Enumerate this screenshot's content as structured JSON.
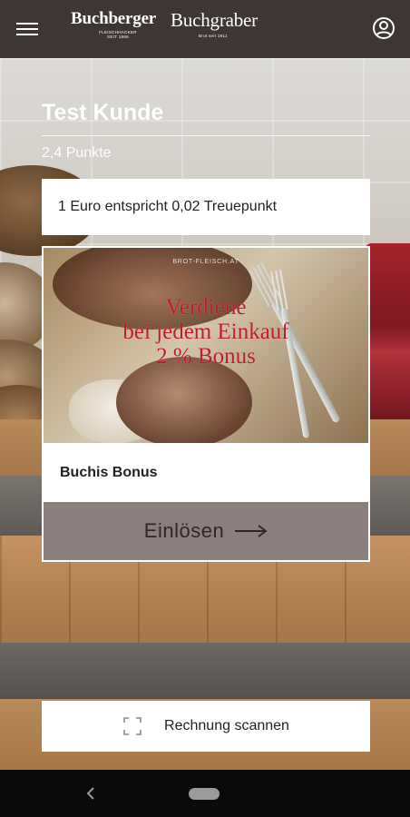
{
  "app": {
    "logo": {
      "brand_primary": "Buchberger",
      "brand_primary_sub": "FLEISCHHACKER SEIT 1966",
      "brand_secondary": "Buchgraber",
      "brand_secondary_sub": "Brot seit 1911"
    },
    "icons": {
      "menu": "hamburger-menu-icon",
      "account": "account-circle-icon",
      "scan": "scan-frame-icon",
      "redeem_arrow": "arrow-right-icon",
      "nav_back": "chevron-left-icon"
    },
    "colors": {
      "topbar": "#3d3634",
      "redeem_button": "#8b7e7c",
      "headline_red": "#c01d2a"
    }
  },
  "header": {
    "user_name": "Test Kunde",
    "points": "2,4 Punkte"
  },
  "info_card": {
    "text": "1 Euro entspricht 0,02 Treuepunkt"
  },
  "bonus_card": {
    "promo_site": "BROT-FLEISCH.AT",
    "promo_line1": "Verdiene",
    "promo_line2": "bei jedem Einkauf",
    "promo_line3": "2 % Bonus",
    "title": "Buchis Bonus",
    "redeem_label": "Einlösen"
  },
  "scan_button": {
    "label": "Rechnung scannen"
  }
}
